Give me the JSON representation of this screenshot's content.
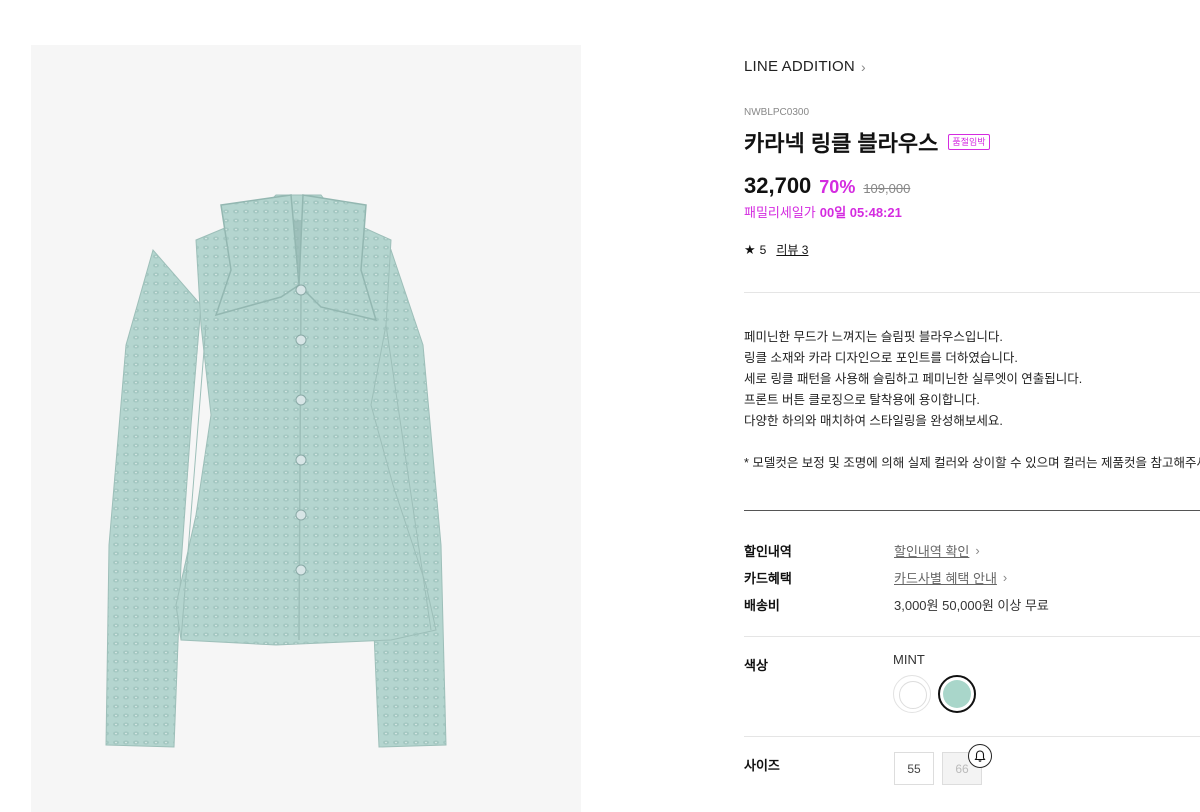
{
  "product": {
    "brand": "LINE ADDITION",
    "code": "NWBLPC0300",
    "title": "카라넥 링클 블라우스",
    "badge": "품절임박",
    "price": "32,700",
    "discount": "70%",
    "original_price": "109,000",
    "sale_label": "패밀리세일가",
    "sale_timer": "00일 05:48:21",
    "rating": "5",
    "review_link": "리뷰 3"
  },
  "description": {
    "lines": [
      "페미닌한 무드가 느껴지는 슬림핏 블라우스입니다.",
      "링클 소재와 카라 디자인으로 포인트를 더하였습니다.",
      "세로 링클 패턴을 사용해 슬림하고 페미닌한 실루엣이 연출됩니다.",
      "프론트 버튼 클로징으로 탈착용에 용이합니다.",
      "다양한 하의와 매치하여 스타일링을 완성해보세요."
    ],
    "note": "* 모델컷은 보정 및 조명에 의해 실제 컬러와 상이할 수 있으며 컬러는 제품컷을 참고해주세요."
  },
  "specs": {
    "discount_label": "할인내역",
    "discount_value": "할인내역 확인",
    "card_label": "카드혜택",
    "card_value": "카드사별 혜택 안내",
    "shipping_label": "배송비",
    "shipping_value": "3,000원 50,000원 이상 무료"
  },
  "color": {
    "label": "색상",
    "selected_name": "MINT",
    "options": [
      "white",
      "mint"
    ],
    "mint_hex": "#a9d6ca"
  },
  "size": {
    "label": "사이즈",
    "options": [
      "55",
      "66"
    ]
  },
  "icons": {
    "brand_chevron": "chevron-right-icon",
    "star": "star-icon",
    "bell": "bell-icon"
  },
  "colors": {
    "accent": "#d42be0",
    "garment": "#b6d6d1"
  }
}
